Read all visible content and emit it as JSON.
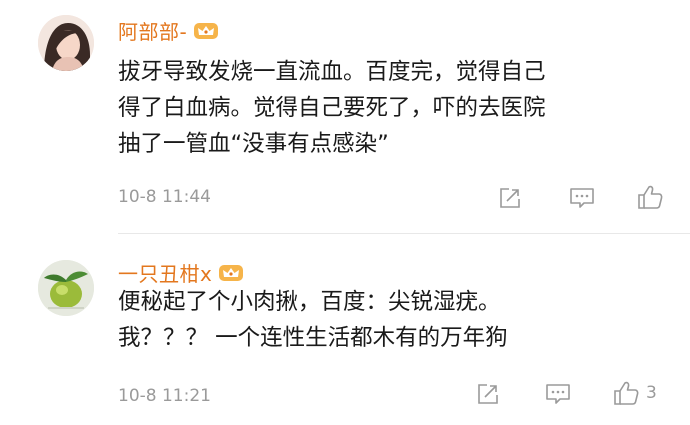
{
  "comments": [
    {
      "username": "阿部部-",
      "lines": [
        "拔牙导致发烧一直流血。百度完，觉得自己",
        "得了白血病。觉得自己要死了，吓的去医院",
        "抽了一管血“没事有点感染”"
      ],
      "time": "10-8 11:44",
      "likes": ""
    },
    {
      "username": "一只丑柑x",
      "lines": [
        "便秘起了个小肉揪，百度：尖锐湿疣。",
        "我？？？ 一个连性生活都木有的万年狗"
      ],
      "time": "10-8 11:21",
      "likes": "3"
    }
  ],
  "icons": [
    "crown-badge-icon",
    "share-icon",
    "reply-icon",
    "like-icon"
  ],
  "colors": {
    "username": "#e3771e",
    "meta": "#9a9a9a",
    "text": "#1a1a1a"
  }
}
